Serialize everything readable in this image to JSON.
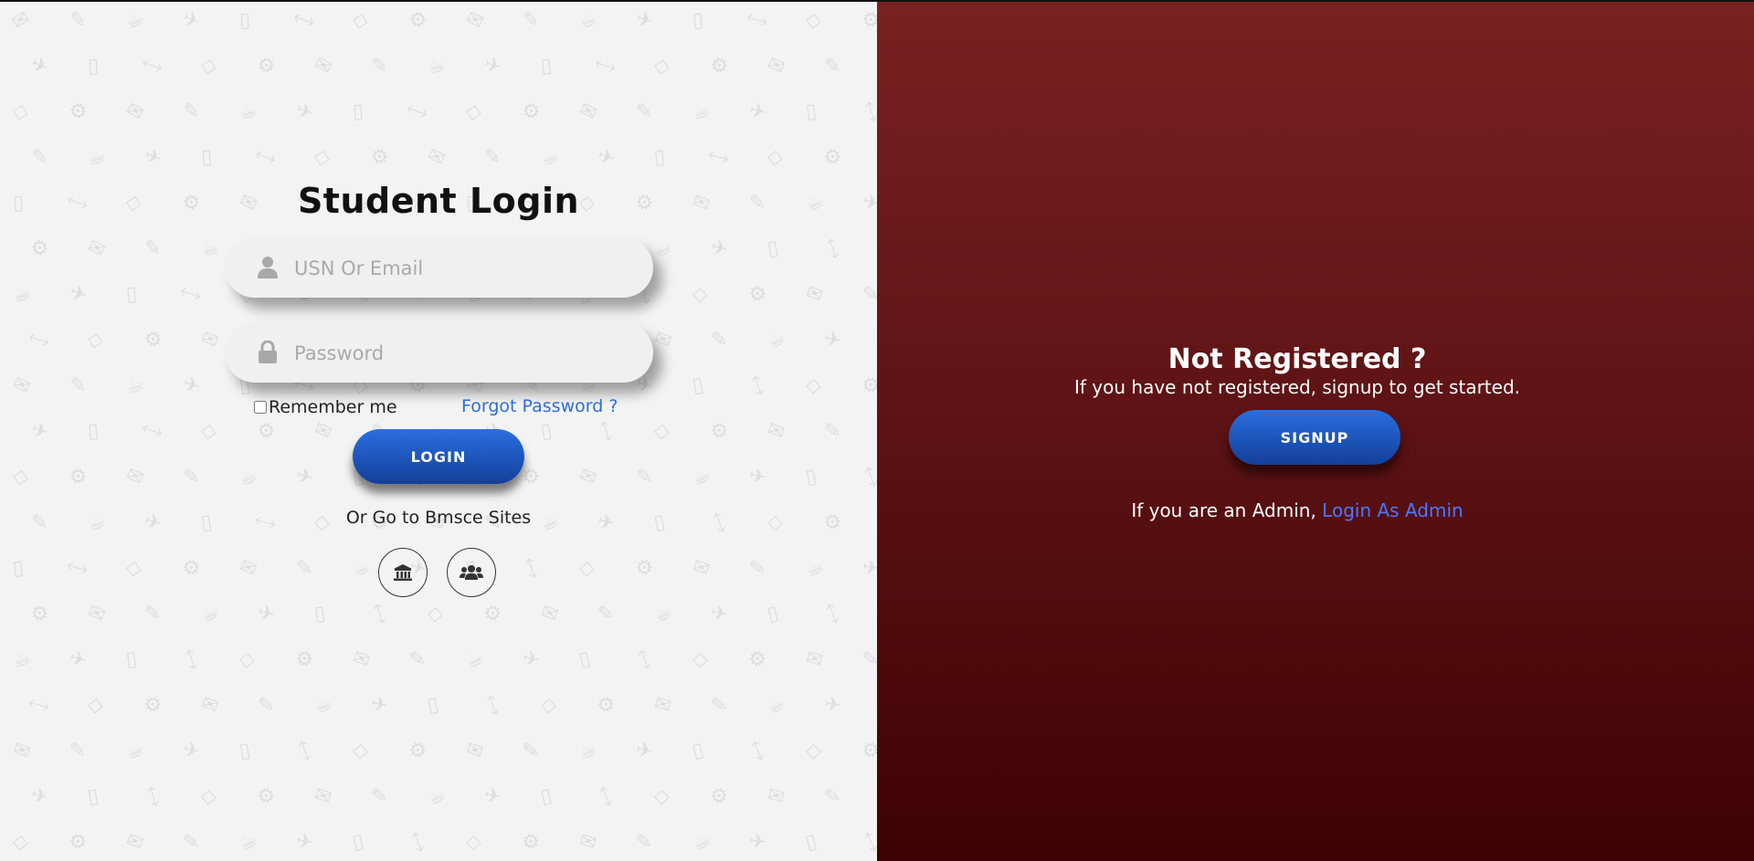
{
  "login": {
    "title": "Student Login",
    "username_placeholder": "USN Or Email",
    "password_placeholder": "Password",
    "remember_label": "Remember me",
    "forgot_link": "Forgot Password ?",
    "login_button": "LOGIN",
    "sites_text": "Or Go to Bmsce Sites",
    "site_buttons": [
      {
        "icon": "institution-icon"
      },
      {
        "icon": "users-icon"
      }
    ]
  },
  "register": {
    "title": "Not Registered ?",
    "subtitle": "If you have not registered, signup to get started.",
    "signup_button": "SIGNUP",
    "admin_prefix": "If you are an Admin, ",
    "admin_link": "Login As Admin"
  },
  "colors": {
    "button_gradient_top": "#2a6fe0",
    "button_gradient_bottom": "#133f9a",
    "link_blue": "#2f6ddb",
    "right_panel_top": "#7a2020",
    "right_panel_bottom": "#3e0203",
    "left_panel_bg": "#f3f3f3"
  }
}
